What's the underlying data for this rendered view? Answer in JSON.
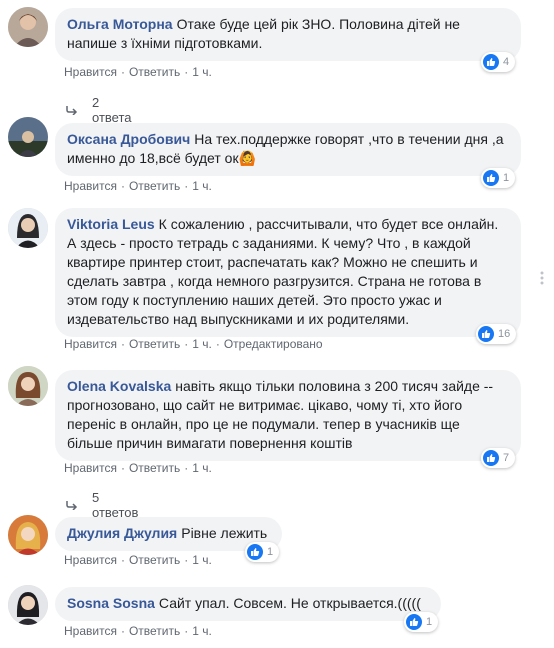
{
  "comments": [
    {
      "author": "Ольга Моторна",
      "text": "Отаке буде цей рік ЗНО. Половина дітей не напише з їхніми підготовками.",
      "like": "Нравится",
      "reply": "Ответить",
      "time": "1 ч.",
      "reactions": "4",
      "replies": "2 ответа"
    },
    {
      "author": "Оксана Дробович",
      "text": "На тех.поддержке говорят ,что в течении дня ,а именно до 18,всё будет ок🙆",
      "like": "Нравится",
      "reply": "Ответить",
      "time": "1 ч.",
      "reactions": "1"
    },
    {
      "author": "Viktoria Leus",
      "text": "К сожалению , рассчитывали, что будет все онлайн. А здесь - просто тетрадь с заданиями. К чему? Что , в каждой квартире принтер стоит, распечатать как? Можно не спешить и сделать завтра , когда немного разгрузится. Страна не готова в этом году к поступлению наших детей. Это просто ужас и издевательство над выпускниками и их родителями.",
      "like": "Нравится",
      "reply": "Ответить",
      "time": "1 ч.",
      "edited": "Отредактировано",
      "reactions": "16"
    },
    {
      "author": "Olena Kovalska",
      "text": "навіть якщо тільки половина з 200 тисяч зайде -- прогнозовано, що сайт не витримає. цікаво, чому ті, хто його переніс в онлайн, про це не подумали. тепер в учасників ще більше причин вимагати повернення коштів",
      "like": "Нравится",
      "reply": "Ответить",
      "time": "1 ч.",
      "reactions": "7",
      "replies": "5 ответов"
    },
    {
      "author": "Джулия Джулия",
      "text": "Рівне лежить",
      "like": "Нравится",
      "reply": "Ответить",
      "time": "1 ч.",
      "reactions": "1"
    },
    {
      "author": "Sosna Sosna",
      "text": "Сайт упал. Совсем. Не открывается.(((((",
      "like": "Нравится",
      "reply": "Ответить",
      "time": "1 ч.",
      "reactions": "1"
    }
  ],
  "colors": {
    "author": "#385898",
    "bubble": "#f2f3f5",
    "like_blue": "#1877f2",
    "meta": "#606770"
  },
  "icons": {
    "like": "thumbs-up-icon",
    "reply_arrow": "reply-arrow-icon"
  }
}
